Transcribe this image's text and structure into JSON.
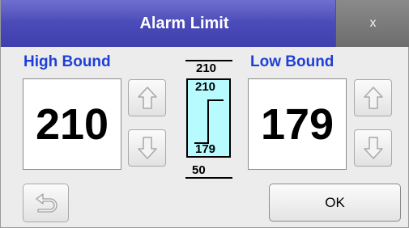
{
  "dialog": {
    "title": "Alarm Limit",
    "close_label": "x"
  },
  "high_bound": {
    "label": "High Bound",
    "value": "210"
  },
  "low_bound": {
    "label": "Low Bound",
    "value": "179"
  },
  "scale": {
    "max": "210",
    "min": "50",
    "indicator_high": "210",
    "indicator_low": "179"
  },
  "buttons": {
    "ok_label": "OK"
  },
  "icons": {
    "up": "up-arrow-icon",
    "down": "down-arrow-icon",
    "back": "return-arrow-icon"
  },
  "colors": {
    "title_bar": "#4a4ab8",
    "label": "#1f3fd6",
    "indicator_fill": "#b8fbff",
    "close_bar": "#7a7a7a"
  }
}
